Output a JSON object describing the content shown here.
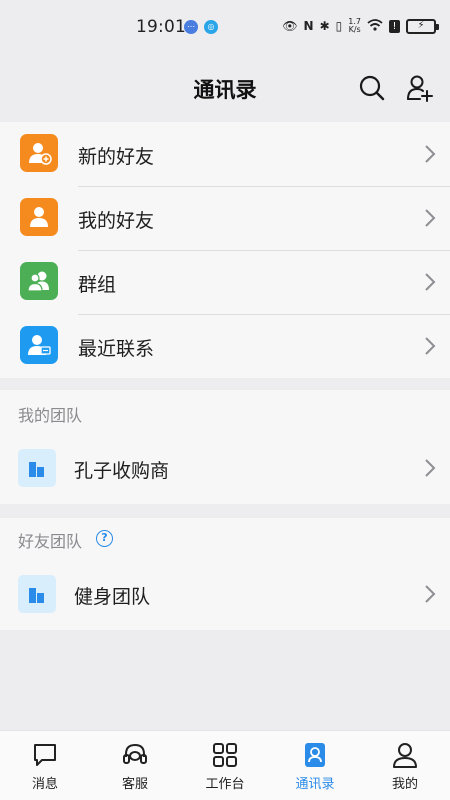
{
  "status_bar": {
    "time": "19:01",
    "net_speed_value": "1.7",
    "net_speed_unit": "K/s"
  },
  "header": {
    "title": "通讯录"
  },
  "menu": {
    "items": [
      {
        "label": "新的好友",
        "icon": "add-friend-icon",
        "color": "#f58b1e"
      },
      {
        "label": "我的好友",
        "icon": "friend-icon",
        "color": "#f58b1e"
      },
      {
        "label": "群组",
        "icon": "group-icon",
        "color": "#4caf55"
      },
      {
        "label": "最近联系",
        "icon": "recent-contact-icon",
        "color": "#1e9af0"
      }
    ]
  },
  "my_team": {
    "title": "我的团队",
    "items": [
      {
        "label": "孔子收购商"
      }
    ]
  },
  "friend_team": {
    "title": "好友团队",
    "help_icon": "help-icon",
    "items": [
      {
        "label": "健身团队"
      }
    ]
  },
  "tabbar": {
    "tabs": [
      {
        "label": "消息",
        "icon": "message-icon"
      },
      {
        "label": "客服",
        "icon": "headset-icon"
      },
      {
        "label": "工作台",
        "icon": "grid-icon"
      },
      {
        "label": "通讯录",
        "icon": "contacts-icon",
        "active": true
      },
      {
        "label": "我的",
        "icon": "profile-icon"
      }
    ],
    "active_color": "#2a8be8"
  }
}
